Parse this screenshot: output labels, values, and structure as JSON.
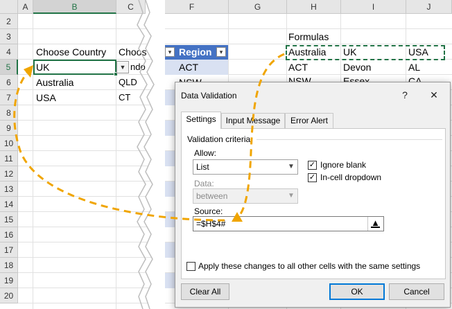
{
  "sheet": {
    "columns": [
      "A",
      "B",
      "C",
      "F",
      "G",
      "H",
      "I",
      "J"
    ],
    "rows": [
      "2",
      "3",
      "4",
      "5",
      "6",
      "7",
      "8",
      "9",
      "10",
      "11",
      "12",
      "13",
      "14",
      "15",
      "16",
      "17",
      "18",
      "19",
      "20"
    ],
    "selected_column": "B",
    "selected_row": "5",
    "cells": {
      "b4": "Choose Country",
      "b5": "UK",
      "b6": "Australia",
      "b7": "USA",
      "c4": "Choos",
      "c5": "ndo",
      "c6": "QLD",
      "c7": "CT",
      "f4": "Region",
      "f5": "ACT",
      "f6": "NSW",
      "h3": "Formulas",
      "h4": "Australia",
      "i4": "UK",
      "j4": "USA",
      "h5": "ACT",
      "i5": "Devon",
      "j5": "AL",
      "h6": "NSW",
      "i6": "Essex",
      "j6": "CA"
    }
  },
  "dialog": {
    "title": "Data Validation",
    "help_icon": "?",
    "close_icon": "✕",
    "tabs": [
      "Settings",
      "Input Message",
      "Error Alert"
    ],
    "active_tab": "Settings",
    "group_label": "Validation criteria",
    "allow_label": "Allow:",
    "allow_value": "List",
    "data_label": "Data:",
    "data_value": "between",
    "ignore_blank_label": "Ignore blank",
    "ignore_blank_checked": true,
    "in_cell_dropdown_label": "In-cell dropdown",
    "in_cell_dropdown_checked": true,
    "source_label": "Source:",
    "source_value": "=$H$4#",
    "apply_label": "Apply these changes to all other cells with the same settings",
    "apply_checked": false,
    "clear_all_label": "Clear All",
    "ok_label": "OK",
    "cancel_label": "Cancel"
  },
  "colors": {
    "accent_green": "#217346",
    "table_header_blue": "#4472c4",
    "table_band": "#d9e1f2",
    "arrow_orange": "#f0a500"
  },
  "icons": [
    "filter-dropdown-icon",
    "sort-filter-icon",
    "collapse-range-icon",
    "checkmark-icon",
    "help-icon",
    "close-icon"
  ]
}
